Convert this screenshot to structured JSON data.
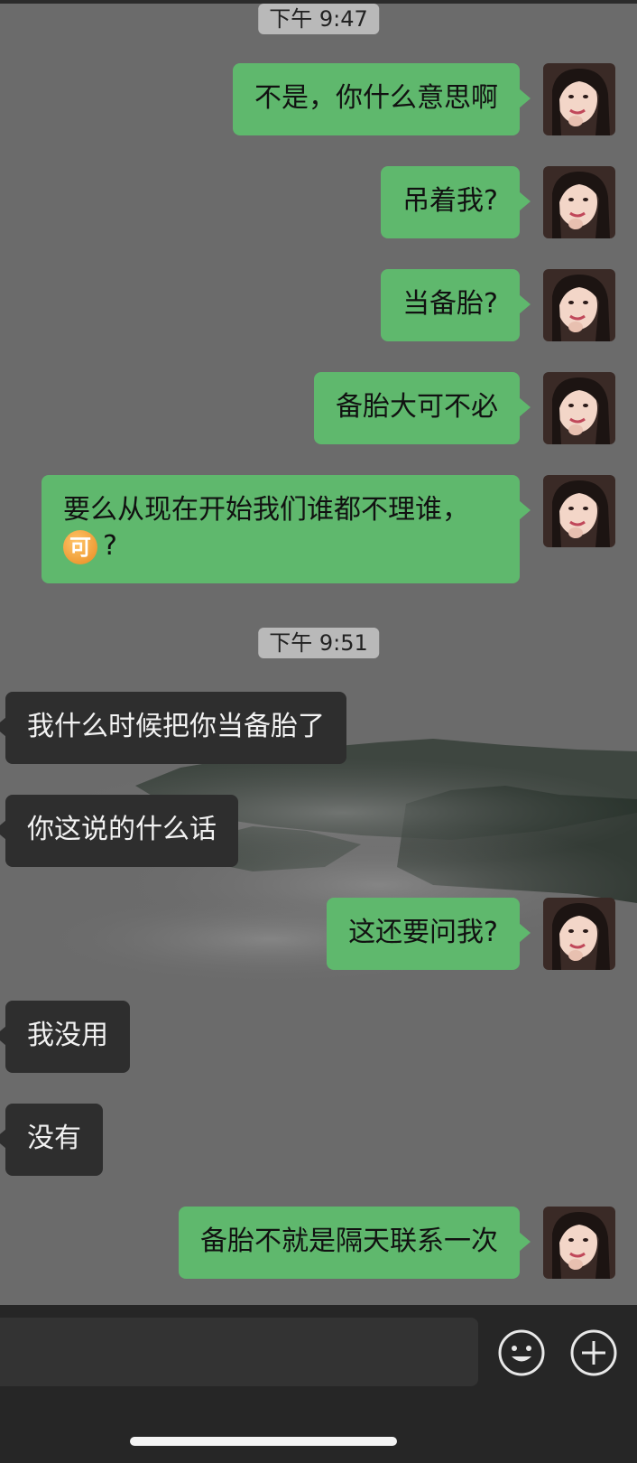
{
  "colors": {
    "background": "#6b6b6b",
    "sent_bubble": "#5fb86d",
    "received_bubble": "#2e2e2e",
    "timestamp_pill": "#b9b9b9",
    "input_bar": "#262626"
  },
  "conversation": {
    "timestamps": [
      "下午 9:47",
      "下午 9:51"
    ],
    "messages": [
      {
        "sender": "me",
        "text": "不是，你什么意思啊"
      },
      {
        "sender": "me",
        "text": "吊着我?"
      },
      {
        "sender": "me",
        "text": "当备胎?"
      },
      {
        "sender": "me",
        "text": "备胎大可不必"
      },
      {
        "sender": "me",
        "text": "要么从现在开始我们谁都不理谁，",
        "sticker": "可",
        "after_sticker": "?"
      },
      {
        "sender": "them",
        "text": "我什么时候把你当备胎了"
      },
      {
        "sender": "them",
        "text": "你这说的什么话"
      },
      {
        "sender": "me",
        "text": "这还要问我?"
      },
      {
        "sender": "them",
        "text": "我没用"
      },
      {
        "sender": "them",
        "text": "没有"
      },
      {
        "sender": "me",
        "text": "备胎不就是隔天联系一次"
      }
    ]
  },
  "input_bar": {
    "input_value": "",
    "emoji_icon": "smiley-face-icon",
    "plus_icon": "plus-circle-icon"
  }
}
